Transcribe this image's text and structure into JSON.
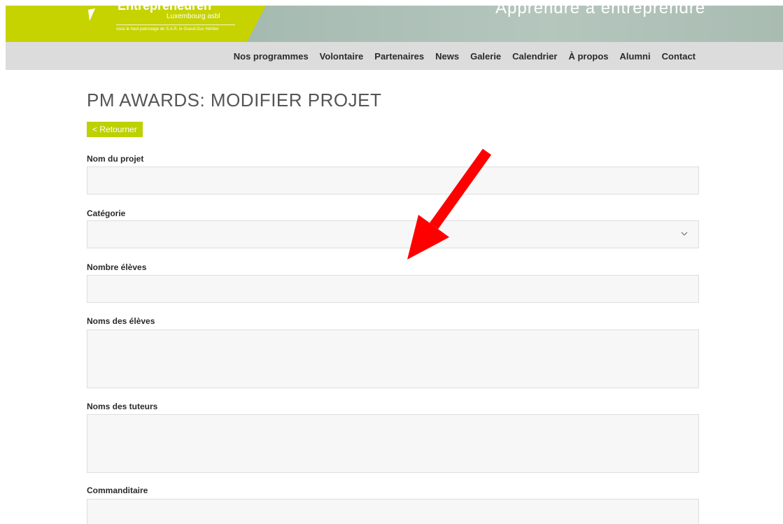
{
  "header": {
    "brand_name": "Entrepreneuren",
    "brand_sub": "Luxembourg asbl",
    "brand_patron": "sous le haut patronage de S.A.R. le Grand-Duc Héritier",
    "tagline": "Apprendre à entreprendre",
    "accent_color": "#c6d300"
  },
  "nav": {
    "items": [
      {
        "label": "Nos programmes"
      },
      {
        "label": "Volontaire"
      },
      {
        "label": "Partenaires"
      },
      {
        "label": "News"
      },
      {
        "label": "Galerie"
      },
      {
        "label": "Calendrier"
      },
      {
        "label": "À propos"
      },
      {
        "label": "Alumni"
      },
      {
        "label": "Contact"
      }
    ]
  },
  "main": {
    "title": "PM AWARDS: MODIFIER PROJET",
    "back_label": "< Retourner",
    "fields": {
      "project_name": {
        "label": "Nom du projet",
        "value": ""
      },
      "category": {
        "label": "Catégorie",
        "value": ""
      },
      "student_count": {
        "label": "Nombre élèves",
        "value": ""
      },
      "student_names": {
        "label": "Noms des élèves",
        "value": ""
      },
      "tutor_names": {
        "label": "Noms des tuteurs",
        "value": ""
      },
      "sponsor": {
        "label": "Commanditaire",
        "value": ""
      }
    }
  },
  "overlay": {
    "arrow_color": "#ff0000",
    "icon": "red-arrow-annotation"
  }
}
